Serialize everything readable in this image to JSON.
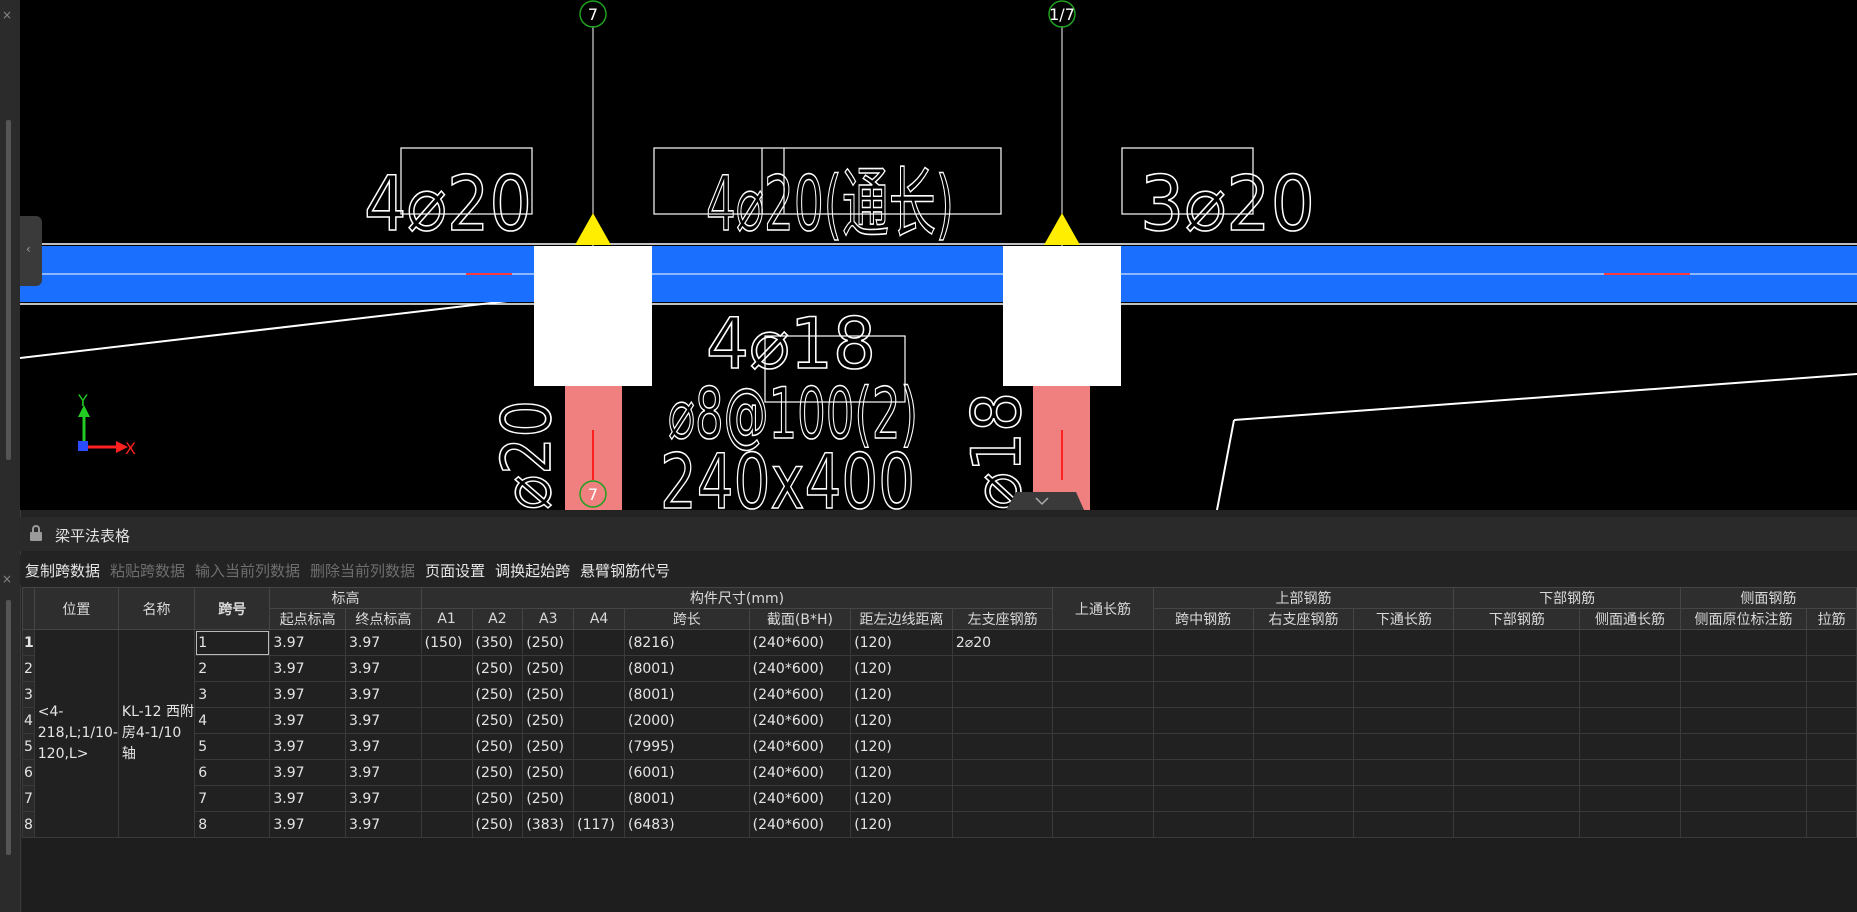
{
  "cad": {
    "axis_top_left": "7",
    "axis_top_right": "1/7",
    "axis_bottom_left": "7",
    "rebar_labels": {
      "left_top": "4⌀20",
      "mid_top": "4⌀20(通长)",
      "right_top": "3⌀20",
      "bottom_bars": "4⌀18",
      "stirrup": "⌀8@100(2)",
      "section": "240x400",
      "left_vertical": "⌀20",
      "right_vertical": "⌀18"
    },
    "ucs": {
      "y": "Y",
      "x": "X"
    },
    "colors": {
      "beam": "#1a6fff",
      "column": "#ffffff",
      "pink_column": "#f08080",
      "axis_circle": "#1fa01f",
      "support": "#ffee00"
    }
  },
  "panel": {
    "title": "梁平法表格",
    "toolbar": [
      {
        "label": "复制跨数据",
        "enabled": true
      },
      {
        "label": "粘贴跨数据",
        "enabled": false
      },
      {
        "label": "输入当前列数据",
        "enabled": false
      },
      {
        "label": "删除当前列数据",
        "enabled": false
      },
      {
        "label": "页面设置",
        "enabled": true
      },
      {
        "label": "调换起始跨",
        "enabled": true
      },
      {
        "label": "悬臂钢筋代号",
        "enabled": true
      }
    ]
  },
  "table": {
    "headers": {
      "position": "位置",
      "name": "名称",
      "span_no": "跨号",
      "elevation": "标高",
      "start_elev": "起点标高",
      "end_elev": "终点标高",
      "dims": "构件尺寸(mm)",
      "a1": "A1",
      "a2": "A2",
      "a3": "A3",
      "a4": "A4",
      "span_len": "跨长",
      "section": "截面(B*H)",
      "edge_dist": "距左边线距离",
      "top_cont": "上通长筋",
      "top_rebar": "上部钢筋",
      "left_support": "左支座钢筋",
      "mid_span": "跨中钢筋",
      "right_support": "右支座钢筋",
      "bottom_rebar": "下部钢筋",
      "bottom_cont": "下通长筋",
      "bottom_bars": "下部钢筋",
      "side_rebar": "侧面钢筋",
      "side_cont": "侧面通长筋",
      "side_orig": "侧面原位标注筋",
      "tie": "拉筋"
    },
    "position_value": "<4-218,L;1/10-120,L>",
    "name_value": "KL-12 西附房4-1/10轴",
    "rows": [
      {
        "n": "1",
        "span": "1",
        "start": "3.97",
        "end": "3.97",
        "a1": "(150)",
        "a2": "(350)",
        "a3": "(250)",
        "a4": "",
        "len": "(8216)",
        "sec": "(240*600)",
        "dist": "(120)",
        "topcont": "2⌀20"
      },
      {
        "n": "2",
        "span": "2",
        "start": "3.97",
        "end": "3.97",
        "a1": "",
        "a2": "(250)",
        "a3": "(250)",
        "a4": "",
        "len": "(8001)",
        "sec": "(240*600)",
        "dist": "(120)",
        "topcont": ""
      },
      {
        "n": "3",
        "span": "3",
        "start": "3.97",
        "end": "3.97",
        "a1": "",
        "a2": "(250)",
        "a3": "(250)",
        "a4": "",
        "len": "(8001)",
        "sec": "(240*600)",
        "dist": "(120)",
        "topcont": ""
      },
      {
        "n": "4",
        "span": "4",
        "start": "3.97",
        "end": "3.97",
        "a1": "",
        "a2": "(250)",
        "a3": "(250)",
        "a4": "",
        "len": "(2000)",
        "sec": "(240*600)",
        "dist": "(120)",
        "topcont": ""
      },
      {
        "n": "5",
        "span": "5",
        "start": "3.97",
        "end": "3.97",
        "a1": "",
        "a2": "(250)",
        "a3": "(250)",
        "a4": "",
        "len": "(7995)",
        "sec": "(240*600)",
        "dist": "(120)",
        "topcont": ""
      },
      {
        "n": "6",
        "span": "6",
        "start": "3.97",
        "end": "3.97",
        "a1": "",
        "a2": "(250)",
        "a3": "(250)",
        "a4": "",
        "len": "(6001)",
        "sec": "(240*600)",
        "dist": "(120)",
        "topcont": ""
      },
      {
        "n": "7",
        "span": "7",
        "start": "3.97",
        "end": "3.97",
        "a1": "",
        "a2": "(250)",
        "a3": "(250)",
        "a4": "",
        "len": "(8001)",
        "sec": "(240*600)",
        "dist": "(120)",
        "topcont": ""
      },
      {
        "n": "8",
        "span": "8",
        "start": "3.97",
        "end": "3.97",
        "a1": "",
        "a2": "(250)",
        "a3": "(383)",
        "a4": "(117)",
        "len": "(6483)",
        "sec": "(240*600)",
        "dist": "(120)",
        "topcont": ""
      }
    ]
  }
}
